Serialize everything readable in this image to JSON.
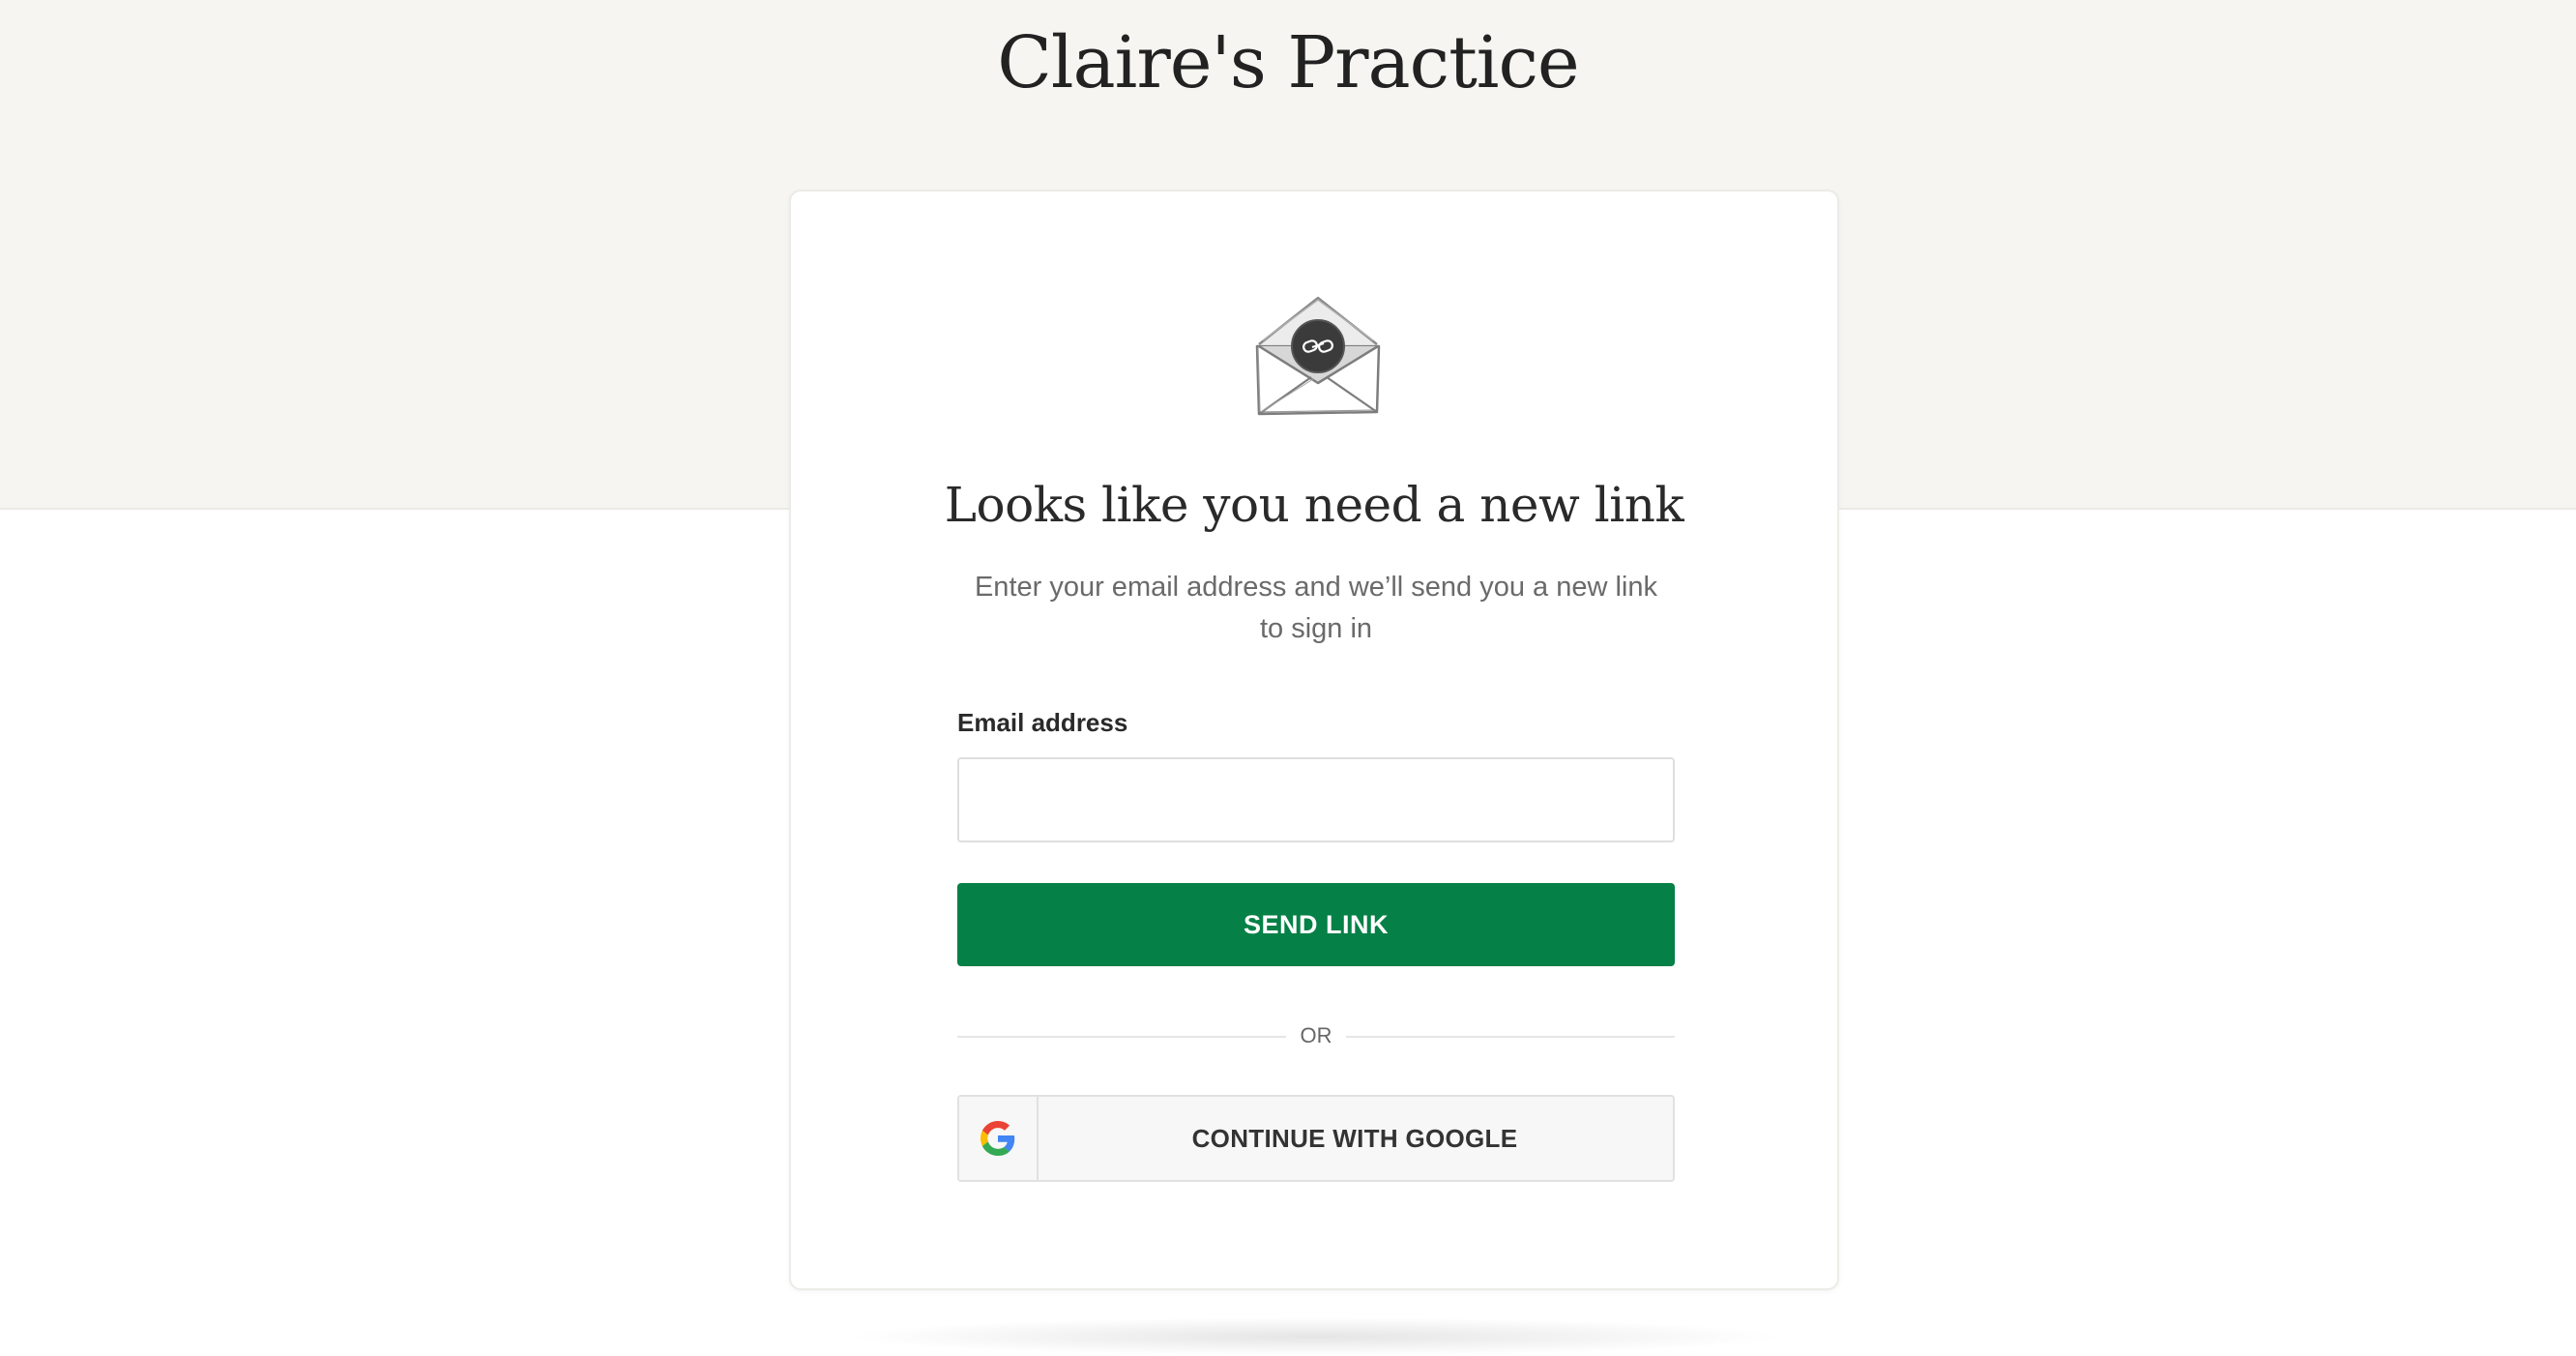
{
  "header": {
    "title": "Claire's Practice"
  },
  "card": {
    "illustration": "envelope-with-link-icon",
    "heading": "Looks like you need a new link",
    "subtext": "Enter your email address and we’ll send you a new link to sign in",
    "email": {
      "label": "Email address",
      "value": "",
      "placeholder": ""
    },
    "send_button_label": "SEND LINK",
    "divider_text": "OR",
    "google_button": {
      "label": "CONTINUE WITH GOOGLE",
      "icon": "google-icon"
    }
  },
  "colors": {
    "top_band": "#f6f5f1",
    "primary_button": "#058046",
    "google_button_bg": "#f7f7f7"
  }
}
